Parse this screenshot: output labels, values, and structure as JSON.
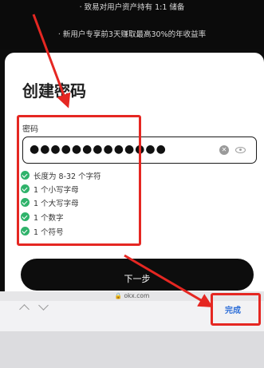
{
  "banner": {
    "line1": "· 致易对用户资产持有 1:1 储备",
    "line2": "· 新用户专享前3天赚取最高30%的年收益率"
  },
  "form": {
    "title": "创建密码",
    "password_label": "密码",
    "password_value": "●●●●●●●●●●●●●"
  },
  "rules": [
    {
      "text": "长度为 8-32 个字符",
      "met": true
    },
    {
      "text": "1 个小写字母",
      "met": true
    },
    {
      "text": "1 个大写字母",
      "met": true
    },
    {
      "text": "1 个数字",
      "met": true
    },
    {
      "text": "1 个符号",
      "met": true
    }
  ],
  "next_label": "下一步",
  "keyboard": {
    "domain": "🔒 okx.com",
    "done_label": "完成"
  },
  "colors": {
    "annotation_red": "#e52722",
    "check_green": "#2fb36b",
    "done_blue": "#2f6fd8"
  }
}
